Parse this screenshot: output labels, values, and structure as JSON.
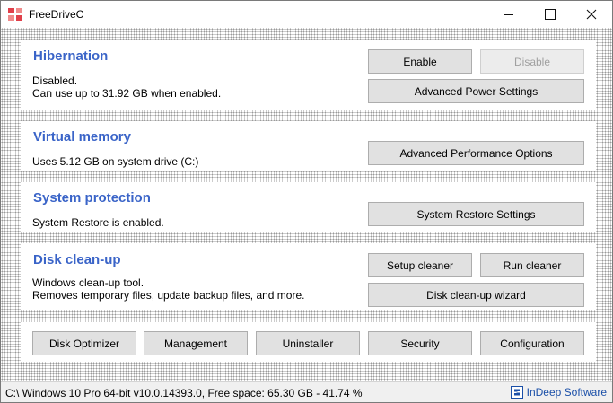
{
  "window": {
    "title": "FreeDriveC"
  },
  "hibernation": {
    "heading": "Hibernation",
    "status": "Disabled.",
    "detail": "Can use up to 31.92 GB when enabled.",
    "enable_label": "Enable",
    "disable_label": "Disable",
    "power_settings_label": "Advanced Power Settings"
  },
  "virtual_memory": {
    "heading": "Virtual memory",
    "detail": "Uses 5.12 GB on system drive (C:)",
    "performance_label": "Advanced Performance Options"
  },
  "system_protection": {
    "heading": "System protection",
    "detail": "System Restore is enabled.",
    "restore_settings_label": "System Restore Settings"
  },
  "disk_cleanup": {
    "heading": "Disk clean-up",
    "line1": "Windows clean-up tool.",
    "line2": "Removes temporary files, update backup files, and more.",
    "setup_label": "Setup cleaner",
    "run_label": "Run cleaner",
    "wizard_label": "Disk clean-up wizard"
  },
  "tools": {
    "items": [
      "Disk Optimizer",
      "Management",
      "Uninstaller",
      "Security",
      "Configuration"
    ]
  },
  "statusbar": {
    "text": "C:\\ Windows 10 Pro 64-bit v10.0.14393.0, Free space: 65.30 GB - 41.74 %",
    "brand": "InDeep Software"
  },
  "colors": {
    "heading": "#3a64c8",
    "brand": "#1a4fa8",
    "app_icon": "#e0404a"
  },
  "icons": {
    "app": "app-icon",
    "minimize": "minimize-icon",
    "maximize": "maximize-icon",
    "close": "close-icon",
    "brand": "indeep-logo-icon"
  }
}
